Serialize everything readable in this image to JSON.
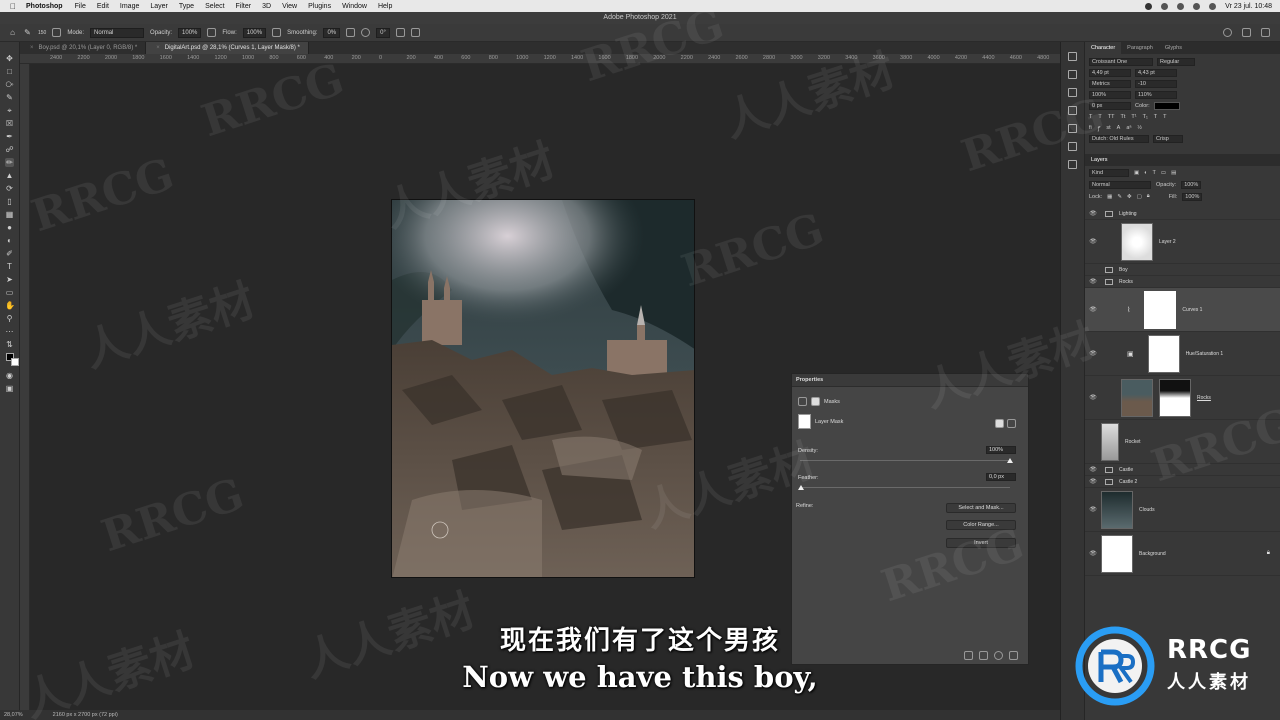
{
  "menubar": {
    "app_name": "Photoshop",
    "menus": [
      "File",
      "Edit",
      "Image",
      "Layer",
      "Type",
      "Select",
      "Filter",
      "3D",
      "View",
      "Plugins",
      "Window",
      "Help"
    ],
    "datetime": "Vr 23 jul.  10:48"
  },
  "window_title": "Adobe Photoshop 2021",
  "options": {
    "brush_size": "150",
    "mode_label": "Mode:",
    "mode_value": "Normal",
    "opacity_label": "Opacity:",
    "opacity_value": "100%",
    "flow_label": "Flow:",
    "flow_value": "100%",
    "smoothing_label": "Smoothing:",
    "smoothing_value": "0%",
    "angle_value": "0°"
  },
  "tabs": [
    {
      "label": "Boy.psd @ 20,1% (Layer 0, RGB/8) *"
    },
    {
      "label": "DigitalArt.psd @ 28,1% (Curves 1, Layer Mask/8) *"
    }
  ],
  "ruler_ticks": [
    "2400",
    "2200",
    "2000",
    "1800",
    "1600",
    "1400",
    "1200",
    "1000",
    "800",
    "600",
    "400",
    "200",
    "0",
    "200",
    "400",
    "600",
    "800",
    "1000",
    "1200",
    "1400",
    "1600",
    "1800",
    "2000",
    "2200",
    "2400",
    "2600",
    "2800",
    "3000",
    "3200",
    "3400",
    "3600",
    "3800",
    "4000",
    "4200",
    "4400",
    "4600",
    "4800"
  ],
  "status": {
    "zoom": "28,07%",
    "doc_size": "2160 px x 2700 px (72 ppi)"
  },
  "character": {
    "tabs": [
      "Character",
      "Paragraph",
      "Glyphs"
    ],
    "font_family": "Croissant One",
    "font_style": "Regular",
    "font_size": "4,49 pt",
    "leading": "4,43 pt",
    "kerning": "Metrics",
    "tracking": "-10",
    "vscale": "100%",
    "hscale": "110%",
    "baseline": "0 px",
    "color_label": "Color:",
    "language": "Dutch: Old Rules",
    "antialias": "Crisp"
  },
  "layers_panel": {
    "title": "Layers",
    "filter_kind": "Kind",
    "blend_mode": "Normal",
    "opacity_label": "Opacity:",
    "opacity_value": "100%",
    "lock_label": "Lock:",
    "fill_label": "Fill:",
    "fill_value": "100%",
    "layers": [
      {
        "name": "Lighting"
      },
      {
        "name": "Layer 2"
      },
      {
        "name": "Boy"
      },
      {
        "name": "Rocks"
      },
      {
        "name": "Curves 1"
      },
      {
        "name": "Hue/Saturation 1"
      },
      {
        "name": "Rocks"
      },
      {
        "name": "Rocket"
      },
      {
        "name": "Castle"
      },
      {
        "name": "Castle 2"
      },
      {
        "name": "Clouds"
      },
      {
        "name": "Background"
      }
    ]
  },
  "properties": {
    "title": "Properties",
    "section": "Masks",
    "mask_type": "Layer Mask",
    "density_label": "Density:",
    "density_value": "100%",
    "density_level": 1.0,
    "feather_label": "Feather:",
    "feather_value": "0,0 px",
    "refine_label": "Refine:",
    "btn_select_mask": "Select and Mask...",
    "btn_color_range": "Color Range...",
    "btn_invert": "Invert"
  },
  "subtitles": {
    "chinese": "现在我们有了这个男孩",
    "english": "Now we have this boy,"
  },
  "watermark": {
    "text_en": "RRCG",
    "text_cn": "人人素材"
  },
  "logo": {
    "text": "RRCG",
    "subtext": "人人素材"
  }
}
